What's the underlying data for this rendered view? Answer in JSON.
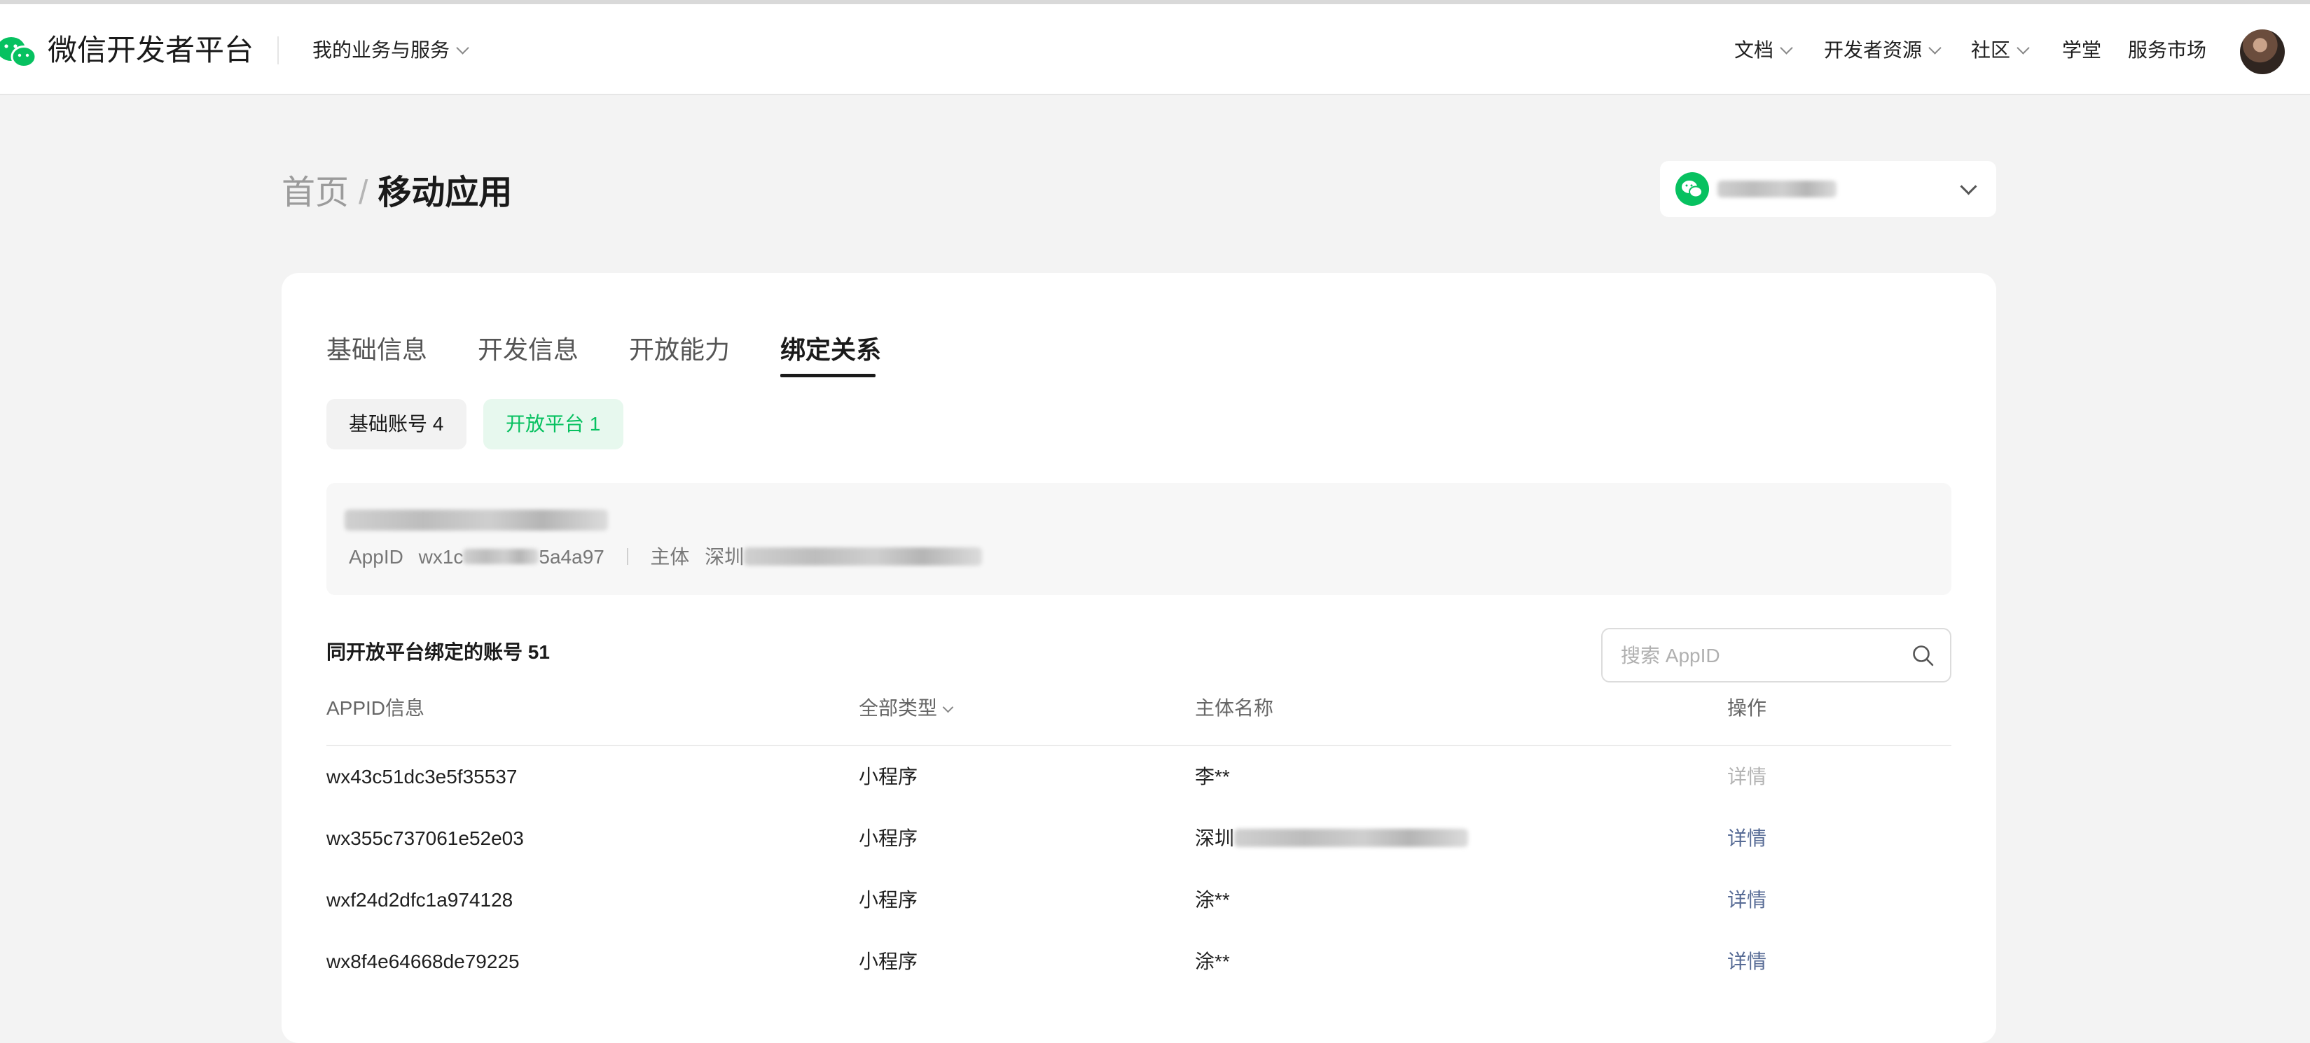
{
  "navbar": {
    "logo_text": "微信开发者平台",
    "my_business": "我的业务与服务",
    "docs": "文档",
    "dev_resources": "开发者资源",
    "community": "社区",
    "academy": "学堂",
    "service_market": "服务市场"
  },
  "breadcrumb": {
    "home": "首页",
    "separator": "/",
    "current": "移动应用"
  },
  "tabs": [
    "基础信息",
    "开发信息",
    "开放能力",
    "绑定关系"
  ],
  "active_tab": "绑定关系",
  "chips": {
    "basic_account": "基础账号 4",
    "open_platform": "开放平台 1"
  },
  "open_platform_info": {
    "appid_label": "AppID",
    "appid_prefix": "wx1c",
    "appid_suffix": "5a4a97",
    "subject_label": "主体",
    "subject_prefix": "深圳"
  },
  "bound": {
    "title": "同开放平台绑定的账号 51"
  },
  "search": {
    "placeholder": "搜索 AppID"
  },
  "table": {
    "headers": {
      "appid": "APPID信息",
      "type": "全部类型",
      "subject": "主体名称",
      "action": "操作"
    },
    "rows": [
      {
        "appid": "wx43c51dc3e5f35537",
        "type": "小程序",
        "subject": "李**",
        "action": "详情",
        "action_enabled": false
      },
      {
        "appid": "wx355c737061e52e03",
        "type": "小程序",
        "subject": "深圳",
        "action": "详情",
        "action_enabled": true
      },
      {
        "appid": "wxf24d2dfc1a974128",
        "type": "小程序",
        "subject": "涂**",
        "action": "详情",
        "action_enabled": true
      },
      {
        "appid": "wx8f4e64668de79225",
        "type": "小程序",
        "subject": "涂**",
        "action": "详情",
        "action_enabled": true
      }
    ]
  },
  "colors": {
    "brand_green": "#07c160",
    "link_blue": "#576b95",
    "disabled_link": "#b2b2b2",
    "background": "#f3f3f3"
  },
  "icons": [
    "wechat-logo-icon",
    "chevron-down-icon",
    "search-icon",
    "avatar"
  ]
}
